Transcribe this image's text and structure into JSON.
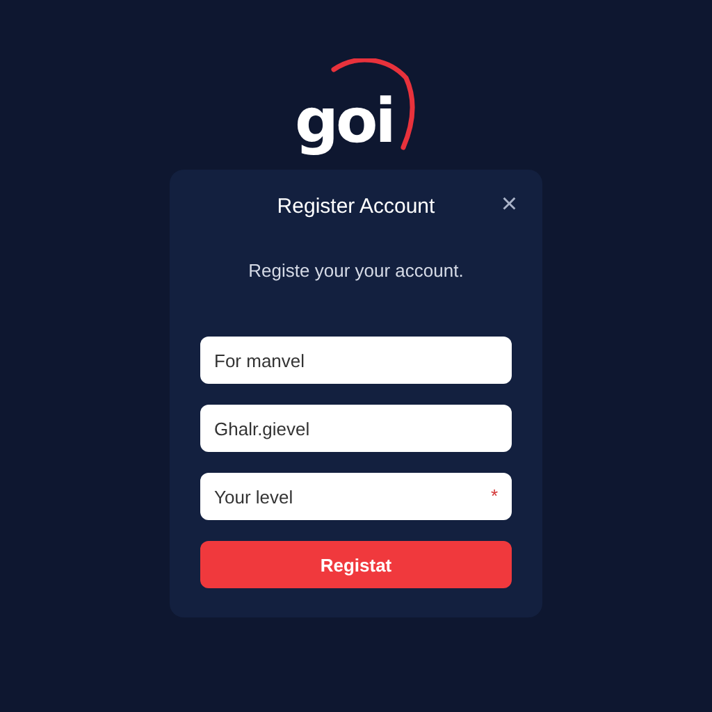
{
  "logo": {
    "text": "goi"
  },
  "dialog": {
    "title": "Register Account",
    "close": "×",
    "subtitle": "Registe your your account.",
    "fields": [
      {
        "placeholder": "For manvel"
      },
      {
        "placeholder": "Ghalr.gievel"
      },
      {
        "placeholder": "Your level",
        "required_mark": "*"
      }
    ],
    "button": "Registat"
  }
}
